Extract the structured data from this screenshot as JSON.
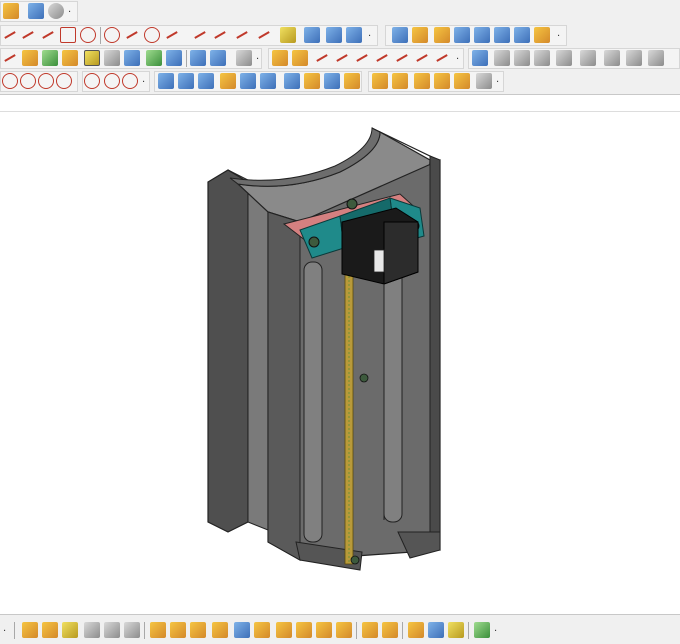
{
  "window": {
    "title": ""
  },
  "toolbars": {
    "row1": [
      "sketch-tool-icon",
      "document-tool-icon",
      "render-sphere-icon"
    ],
    "row2": [
      "point-icon",
      "multipoint-icon",
      "line-icon",
      "rectangle-icon",
      "circle-icon",
      "ellipse-icon",
      "spline-icon",
      "polygon-icon",
      "curve-icon",
      "trim-icon",
      "extend-icon",
      "fillet-icon",
      "chamfer-icon",
      "offset-icon",
      "mirror-icon",
      "pattern-icon",
      "extrude-icon",
      "revolve-icon",
      "sweep-icon",
      "loft-icon",
      "shell-icon",
      "draft-icon",
      "rib-icon",
      "hole-icon",
      "thread-icon",
      "boolean-icon",
      "split-icon"
    ],
    "row3": [
      "constraint-icon",
      "dimension-icon",
      "select-icon",
      "move-icon",
      "rotate-icon",
      "box-icon",
      "cylinder-icon",
      "cone-icon",
      "sphere-icon",
      "torus-icon",
      "assembly-icon",
      "component-icon",
      "measure-icon",
      "section-icon",
      "explode-icon",
      "smooth-icon",
      "blend-icon",
      "bend-icon",
      "surface-icon",
      "patch-icon",
      "knit-icon",
      "thicken-icon",
      "stitch-icon"
    ],
    "row4": [
      "circle-point-icon",
      "circle-tangent-icon",
      "circle-center-icon",
      "circle-three-point-icon",
      "arc-icon",
      "arc-tangent-icon",
      "arc-center-icon",
      "surface-ruled-icon",
      "surface-sweep-icon",
      "surface-blend-icon",
      "surface-loft-icon",
      "surface-boundary-icon",
      "surface-fill-icon",
      "surface-trim-icon",
      "surface-extend-icon",
      "surface-offset-icon",
      "surface-split-icon",
      "surface-join-icon",
      "surface-edit-icon",
      "surface-analyze-icon"
    ],
    "bottom": [
      "view-front-icon",
      "view-back-icon",
      "view-top-icon",
      "view-bottom-icon",
      "view-left-icon",
      "view-right-icon",
      "view-iso-icon",
      "zoom-icon",
      "pan-icon",
      "rotate-view-icon",
      "fit-icon",
      "shade-icon",
      "wireframe-icon",
      "hidden-line-icon",
      "perspective-icon",
      "light-icon",
      "material-icon",
      "export-icon"
    ]
  },
  "colors": {
    "body_gray": "#6b6b6b",
    "body_dark": "#4a4a4a",
    "body_light": "#9a9a9a",
    "rail_gold": "#b89a3a",
    "bracket_teal": "#1f8a8a",
    "belt_pink": "#d48080",
    "motor_black": "#1a1a1a"
  }
}
